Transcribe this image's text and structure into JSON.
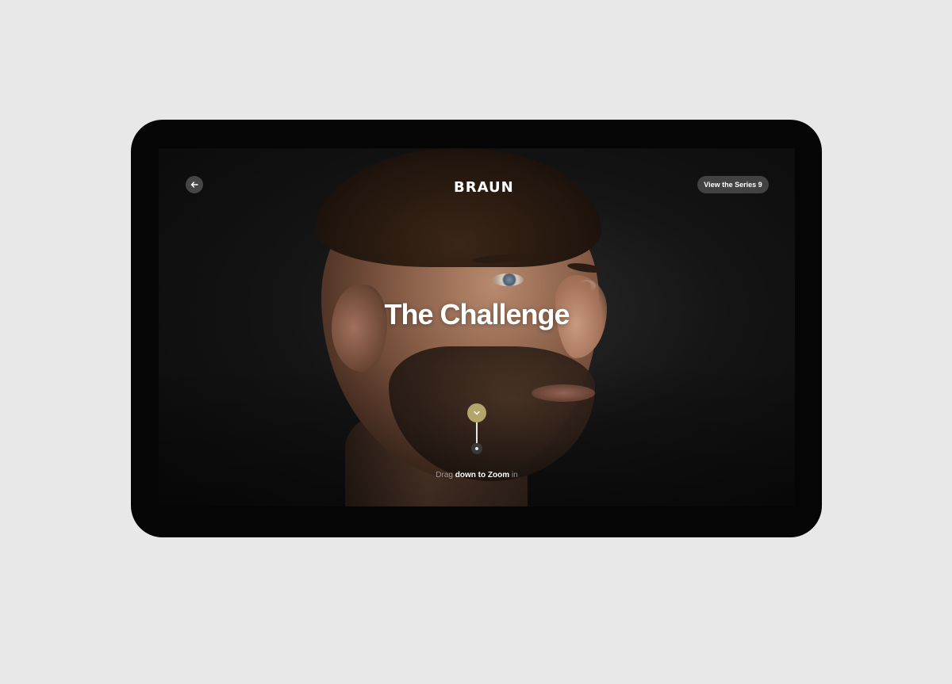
{
  "app": {
    "brand": "BRAUN",
    "back_icon": "arrow-left-icon",
    "cta_label": "View the Series 9"
  },
  "hero": {
    "title": "The Challenge"
  },
  "drag": {
    "handle_icon": "chevron-down-icon",
    "hint_1": "Drag",
    "hint_2": "down",
    "hint_3": "to",
    "hint_4": "Zoom",
    "hint_5": "in"
  },
  "colors": {
    "accent": "#b4a66a",
    "background": "#0a0a0a",
    "page": "#e8e8e8"
  }
}
